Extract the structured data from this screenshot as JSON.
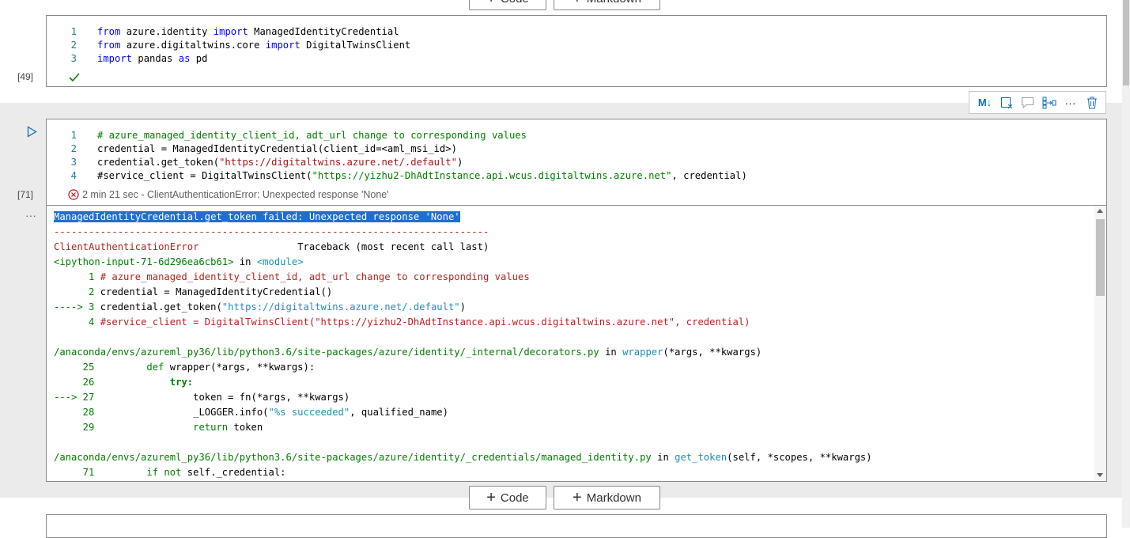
{
  "add_buttons": {
    "code": "Code",
    "markdown": "Markdown"
  },
  "cell1": {
    "exec_count": "[49]",
    "lines": [
      {
        "n": "1",
        "parts": [
          [
            "kw",
            "from"
          ],
          [
            "t",
            " azure.identity "
          ],
          [
            "kw",
            "import"
          ],
          [
            "t",
            " ManagedIdentityCredential"
          ]
        ]
      },
      {
        "n": "2",
        "parts": [
          [
            "kw",
            "from"
          ],
          [
            "t",
            " azure.digitaltwins.core "
          ],
          [
            "kw",
            "import"
          ],
          [
            "t",
            " DigitalTwinsClient"
          ]
        ]
      },
      {
        "n": "3",
        "parts": [
          [
            "kw",
            "import"
          ],
          [
            "t",
            " pandas "
          ],
          [
            "kw",
            "as"
          ],
          [
            "t",
            " pd"
          ]
        ]
      }
    ]
  },
  "toolbar": {
    "icons": [
      "markdown-toggle-icon",
      "clear-output-icon",
      "comment-icon",
      "split-cell-icon",
      "more-icon",
      "delete-icon"
    ],
    "md_label": "M↓",
    "more_label": "···"
  },
  "cell2": {
    "exec_count": "[71]",
    "lines": [
      {
        "n": "1",
        "parts": [
          [
            "cm",
            "# azure_managed_identity_client_id, adt_url change to corresponding values"
          ]
        ]
      },
      {
        "n": "2",
        "parts": [
          [
            "t",
            "credential = ManagedIdentityCredential(client_id=<aml_msi_id>)"
          ]
        ]
      },
      {
        "n": "3",
        "parts": [
          [
            "t",
            "credential.get_token("
          ],
          [
            "str",
            "\"https://digitaltwins.azure.net/.default\""
          ],
          [
            "t",
            ")"
          ]
        ]
      },
      {
        "n": "4",
        "parts": [
          [
            "t",
            "#service_client = DigitalTwinsClient("
          ],
          [
            "cm",
            "\"https://yizhu2-DhAdtInstance.api.wcus.digitaltwins.azure.net\""
          ],
          [
            "t",
            ", credential)"
          ]
        ]
      }
    ],
    "status": "2 min 21 sec - ClientAuthenticationError: Unexpected response 'None'"
  },
  "output": {
    "ellipsis": "···",
    "lines": [
      [
        [
          "hl",
          "ManagedIdentityCredential.get_token failed: Unexpected response 'None'"
        ]
      ],
      [
        [
          "o-red",
          "---------------------------------------------------------------------------"
        ]
      ],
      [
        [
          "o-red",
          "ClientAuthenticationError"
        ],
        [
          "t",
          "                 Traceback (most recent call last)"
        ]
      ],
      [
        [
          "o-green",
          "<ipython-input-71-6d296ea6cb61>"
        ],
        [
          "t",
          " in "
        ],
        [
          "o-blue",
          "<module>"
        ]
      ],
      [
        [
          "o-darkgreen",
          "      1 "
        ],
        [
          "o-red",
          "# azure_managed_identity_client_id, adt_url change to corresponding values"
        ]
      ],
      [
        [
          "o-darkgreen",
          "      2 "
        ],
        [
          "t",
          "credential = ManagedIdentityCredential()"
        ]
      ],
      [
        [
          "o-darkgreen",
          "----> 3 "
        ],
        [
          "t",
          "credential.get_token("
        ],
        [
          "o-blue",
          "\"https://digitaltwins.azure.net/.default\""
        ],
        [
          "t",
          ")"
        ]
      ],
      [
        [
          "o-darkgreen",
          "      4 "
        ],
        [
          "o-red",
          "#service_client = DigitalTwinsClient(\"https://yizhu2-DhAdtInstance.api.wcus.digitaltwins.azure.net\", credential)"
        ]
      ],
      [
        [
          "t",
          ""
        ]
      ],
      [
        [
          "o-green",
          "/anaconda/envs/azureml_py36/lib/python3.6/site-packages/azure/identity/_internal/decorators.py"
        ],
        [
          "t",
          " in "
        ],
        [
          "o-blue",
          "wrapper"
        ],
        [
          "t",
          "(*args, **kwargs)"
        ]
      ],
      [
        [
          "o-darkgreen",
          "     25 "
        ],
        [
          "t",
          "        "
        ],
        [
          "o-darkgreen",
          "def"
        ],
        [
          "t",
          " wrapper(*args, **kwargs):"
        ]
      ],
      [
        [
          "o-darkgreen",
          "     26 "
        ],
        [
          "t",
          "            "
        ],
        [
          "o-darkgreen o-bold",
          "try:"
        ]
      ],
      [
        [
          "o-darkgreen",
          "---> 27 "
        ],
        [
          "t",
          "                token = fn(*args, **kwargs)"
        ]
      ],
      [
        [
          "o-darkgreen",
          "     28 "
        ],
        [
          "t",
          "                _LOGGER.info("
        ],
        [
          "o-blue",
          "\"%s succeeded\""
        ],
        [
          "t",
          ", qualified_name)"
        ]
      ],
      [
        [
          "o-darkgreen",
          "     29 "
        ],
        [
          "t",
          "                "
        ],
        [
          "o-darkgreen",
          "return"
        ],
        [
          "t",
          " token"
        ]
      ],
      [
        [
          "t",
          ""
        ]
      ],
      [
        [
          "o-green",
          "/anaconda/envs/azureml_py36/lib/python3.6/site-packages/azure/identity/_credentials/managed_identity.py"
        ],
        [
          "t",
          " in "
        ],
        [
          "o-blue",
          "get_token"
        ],
        [
          "t",
          "(self, *scopes, **kwargs)"
        ]
      ],
      [
        [
          "o-darkgreen",
          "     71 "
        ],
        [
          "t",
          "        "
        ],
        [
          "o-darkgreen",
          "if not"
        ],
        [
          "t",
          " self._credential:"
        ]
      ]
    ]
  }
}
